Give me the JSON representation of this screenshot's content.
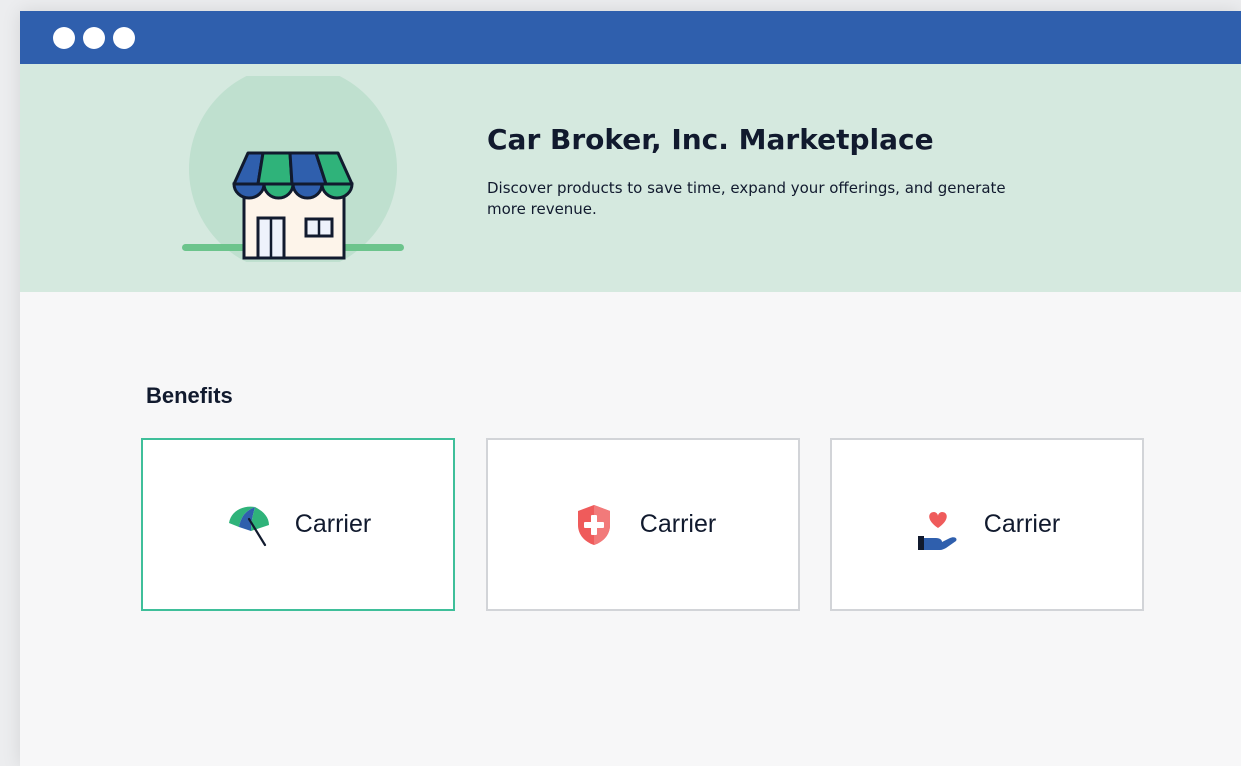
{
  "window": {
    "controls": [
      "window-dot",
      "window-dot",
      "window-dot"
    ]
  },
  "hero": {
    "title": "Car Broker, Inc. Marketplace",
    "subtitle": "Discover products to save time, expand your offerings, and generate more revenue.",
    "illustration_icon": "storefront-icon"
  },
  "benefits": {
    "title": "Benefits",
    "cards": [
      {
        "label": "Carrier",
        "icon": "umbrella-icon",
        "selected": true
      },
      {
        "label": "Carrier",
        "icon": "shield-plus-icon",
        "selected": false
      },
      {
        "label": "Carrier",
        "icon": "hand-heart-icon",
        "selected": false
      }
    ]
  },
  "colors": {
    "titlebar": "#2f5fad",
    "hero_background": "#d5e9df",
    "selected_border": "#3fbf9a",
    "card_border": "#d2d4d8",
    "text": "#111a2e",
    "awning_blue": "#2f5fad",
    "awning_green": "#2fb37a",
    "shield_red": "#ef5b5b",
    "heart_red": "#ef5b5b"
  }
}
